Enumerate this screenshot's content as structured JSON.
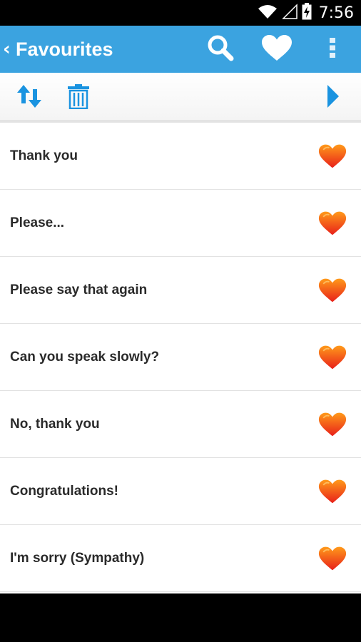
{
  "status_bar": {
    "time": "7:56",
    "icons": [
      "wifi-icon",
      "signal-icon",
      "battery-charging-icon"
    ]
  },
  "action_bar": {
    "title": "Favourites",
    "background": "#3ba3e0",
    "icons": [
      "back-chevron-icon",
      "search-icon",
      "heart-icon",
      "overflow-menu-icon"
    ]
  },
  "toolbar": {
    "icons": [
      "sort-icon",
      "trash-icon",
      "play-icon"
    ],
    "accent": "#1a93e0"
  },
  "favourites": [
    {
      "label": "Thank you"
    },
    {
      "label": "Please..."
    },
    {
      "label": "Please say that again"
    },
    {
      "label": "Can you speak slowly?"
    },
    {
      "label": "No, thank you"
    },
    {
      "label": "Congratulations!"
    },
    {
      "label": "I'm sorry (Sympathy)"
    }
  ],
  "heart_colors": {
    "top": "#ff9a1a",
    "bottom": "#e8201a"
  }
}
